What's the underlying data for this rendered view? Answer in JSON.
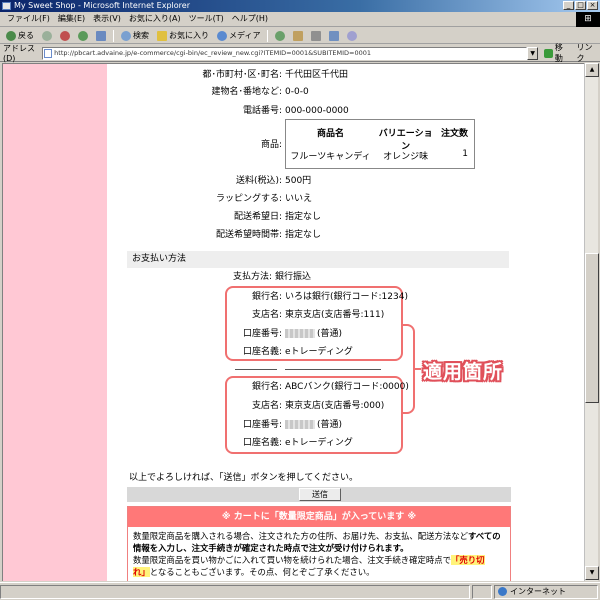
{
  "window": {
    "title": "My Sweet Shop - Microsoft Internet Explorer",
    "controls": [
      "_",
      "□",
      "×"
    ]
  },
  "menu": [
    "ファイル(F)",
    "編集(E)",
    "表示(V)",
    "お気に入り(A)",
    "ツール(T)",
    "ヘルプ(H)"
  ],
  "toolbar": {
    "back": "戻る",
    "search": "検索",
    "favorites": "お気に入り",
    "media": "メディア"
  },
  "address": {
    "label": "アドレス(D)",
    "url": "http://pbcart.advaine.jp/e-commerce/cgi-bin/ec_review_new.cgi?ITEMID=0001&SUBITEMID=0001",
    "go": "移動",
    "links": "リンク"
  },
  "address_rows": [
    {
      "label": "都･市町村･区･町名:",
      "value": "千代田区千代田"
    },
    {
      "label": "建物名･番地など:",
      "value": "0-0-0"
    },
    {
      "label": "電話番号:",
      "value": "000-000-0000"
    }
  ],
  "product": {
    "label": "商品:",
    "headers": [
      "商品名",
      "バリエーション",
      "注文数"
    ],
    "row": [
      "フルーツキャンディ",
      "オレンジ味",
      "1"
    ]
  },
  "order_rows": [
    {
      "label": "送料(税込):",
      "value": "500円"
    },
    {
      "label": "ラッピングする:",
      "value": "いいえ"
    },
    {
      "label": "配送希望日:",
      "value": "指定なし"
    },
    {
      "label": "配送希望時間帯:",
      "value": "指定なし"
    }
  ],
  "payment": {
    "section_title": "お支払い方法",
    "method_label": "支払方法:",
    "method_value": "銀行振込",
    "bank1": [
      {
        "label": "銀行名:",
        "value": "いろは銀行(銀行コード:1234)"
      },
      {
        "label": "支店名:",
        "value": "東京支店(支店番号:111)"
      },
      {
        "label": "口座番号:",
        "value": "(普通)"
      },
      {
        "label": "口座名義:",
        "value": "eトレーディング"
      }
    ],
    "bank2": [
      {
        "label": "銀行名:",
        "value": "ABCバンク(銀行コード:0000)"
      },
      {
        "label": "支店名:",
        "value": "東京支店(支店番号:000)"
      },
      {
        "label": "口座番号:",
        "value": "(普通)"
      },
      {
        "label": "口座名義:",
        "value": "eトレーディング"
      }
    ],
    "annotation": "適用箇所"
  },
  "confirm_text": "以上でよろしければ、「送信」ボタンを押してください。",
  "submit_label": "送信",
  "notice": {
    "title": "※ カートに「数量限定商品」が入っています ※",
    "line1_a": "数量限定商品を購入される場合、注文された方の住所、お届け先、お支払、配送方法など",
    "line1_b": "すべての",
    "line2": "情報を入力し、注文手続きが確定された時点で注文が受け付けられます。",
    "line3_a": "数量限定商品を買い物かごに入れて買い物を続けられた場合、注文手続き確定時点で",
    "line3_b": "「売り切",
    "line4_a": "れ」",
    "line4_b": "となることもございます。その点、何とぞご了承ください。"
  },
  "status": {
    "left": "",
    "zone": "インターネット"
  },
  "colors": {
    "sidebar": "#ffc8d4",
    "annotation": "#e0505a",
    "notice_header": "#ff7878"
  }
}
